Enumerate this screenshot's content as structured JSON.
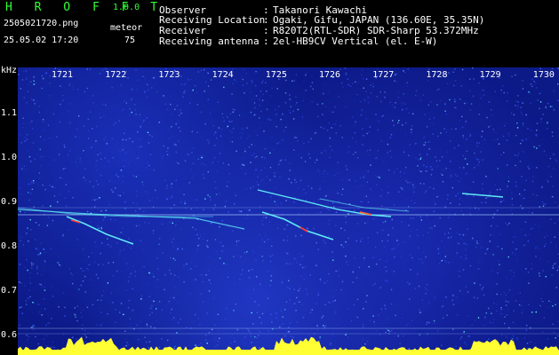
{
  "header": {
    "app_title": "H R O F F T",
    "app_version": "1.0.0",
    "file_name": "2505021720.png",
    "mode_label": "meteor",
    "datetime": "25.05.02 17:20",
    "count": "75"
  },
  "info": {
    "observer_label": "Observer",
    "observer_value": "Takanori Kawachi",
    "location_label": "Receiving Location",
    "location_value": "Ogaki, Gifu, JAPAN (136.60E, 35.35N)",
    "receiver_label": "Receiver",
    "receiver_value": "R820T2(RTL-SDR) SDR-Sharp 53.372MHz",
    "antenna_label": "Receiving antenna",
    "antenna_value": "2el-HB9CV Vertical (el. E-W)",
    "colon": ":"
  },
  "axes": {
    "y_unit": "kHz",
    "y_ticks": [
      {
        "label": "1.1",
        "value": 1.1
      },
      {
        "label": "1.0",
        "value": 1.0
      },
      {
        "label": "0.9",
        "value": 0.9
      },
      {
        "label": "0.8",
        "value": 0.8
      },
      {
        "label": "0.7",
        "value": 0.7
      },
      {
        "label": "0.6",
        "value": 0.6
      }
    ],
    "x_ticks": [
      "1721",
      "1722",
      "1723",
      "1724",
      "1725",
      "1726",
      "1727",
      "1728",
      "1729",
      "1730"
    ]
  },
  "colors": {
    "background": "#000000",
    "title_green": "#33ff33",
    "text_white": "#ffffff",
    "noise_blue": "#1a2fb8",
    "noise_deep": "#0c1a88",
    "signal_cyan": "#66ffff",
    "burst_yellow": "#ffff33",
    "hot_red": "#ff3333"
  }
}
